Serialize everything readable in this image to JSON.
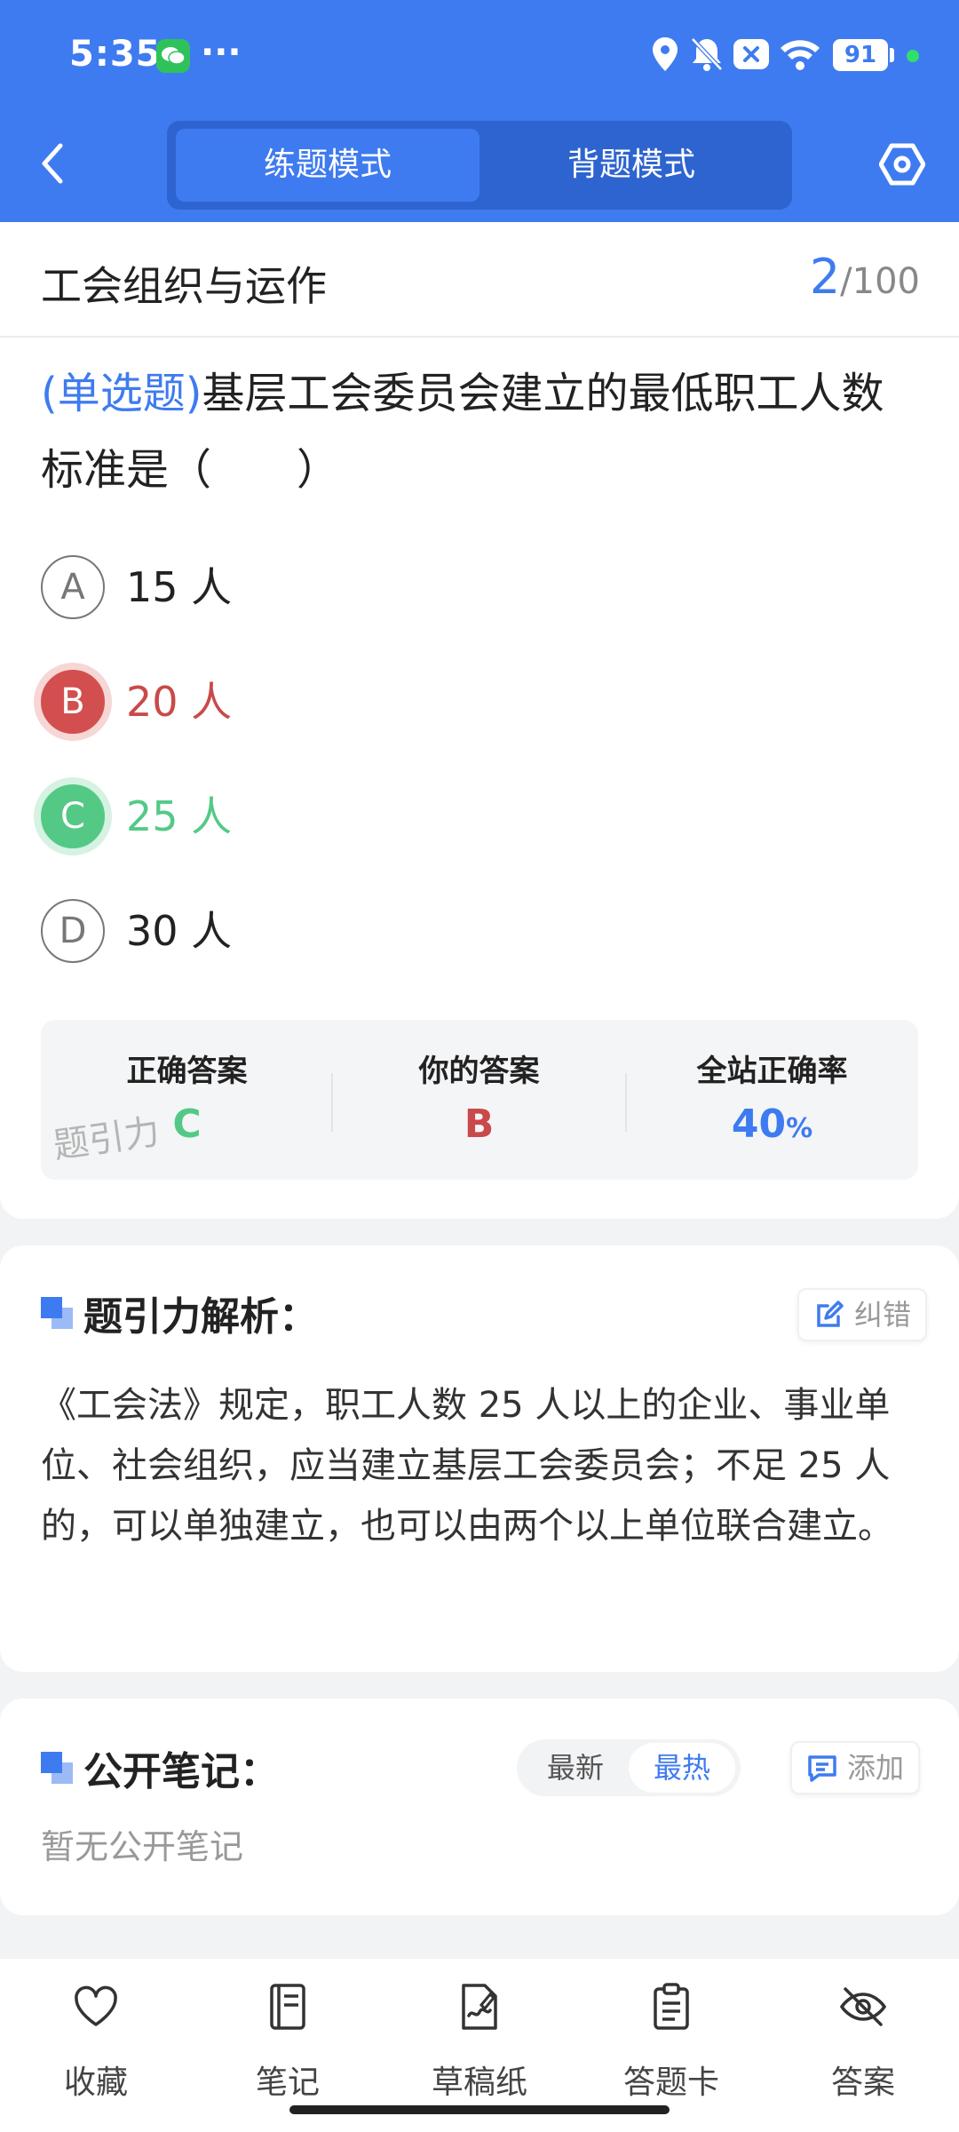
{
  "status_bar": {
    "time": "5:35",
    "more": "···",
    "battery": "91"
  },
  "header": {
    "modes": [
      "练题模式",
      "背题模式"
    ],
    "active_mode": 0
  },
  "question": {
    "category": "工会组织与运作",
    "current": "2",
    "total": "/100",
    "type": "(单选题)",
    "text": "基层工会委员会建立的最低职工人数标准是（　　）",
    "options": [
      {
        "letter": "A",
        "text": "15 人",
        "state": "normal"
      },
      {
        "letter": "B",
        "text": "20 人",
        "state": "wrong"
      },
      {
        "letter": "C",
        "text": "25 人",
        "state": "correct"
      },
      {
        "letter": "D",
        "text": "30 人",
        "state": "normal"
      }
    ]
  },
  "stats": {
    "correct_label": "正确答案",
    "correct_value": "C",
    "yours_label": "你的答案",
    "yours_value": "B",
    "rate_label": "全站正确率",
    "rate_value": "40",
    "rate_unit": "%",
    "watermark": "题引力"
  },
  "analysis": {
    "title": "题引力解析：",
    "report_label": "纠错",
    "text": "《工会法》规定，职工人数 25 人以上的企业、事业单位、社会组织，应当建立基层工会委员会；不足 25 人的，可以单独建立，也可以由两个以上单位联合建立。"
  },
  "notes": {
    "title": "公开笔记：",
    "sort_options": [
      "最新",
      "最热"
    ],
    "active_sort": 1,
    "add_label": "添加",
    "empty_text": "暂无公开笔记"
  },
  "bottom_nav": [
    {
      "label": "收藏",
      "icon": "heart-icon"
    },
    {
      "label": "笔记",
      "icon": "notebook-icon"
    },
    {
      "label": "草稿纸",
      "icon": "draft-paper-icon"
    },
    {
      "label": "答题卡",
      "icon": "answer-sheet-icon"
    },
    {
      "label": "答案",
      "icon": "eye-off-icon"
    }
  ],
  "colors": {
    "primary": "#3f7bf0",
    "wrong": "#d34f4f",
    "correct": "#54c986"
  }
}
